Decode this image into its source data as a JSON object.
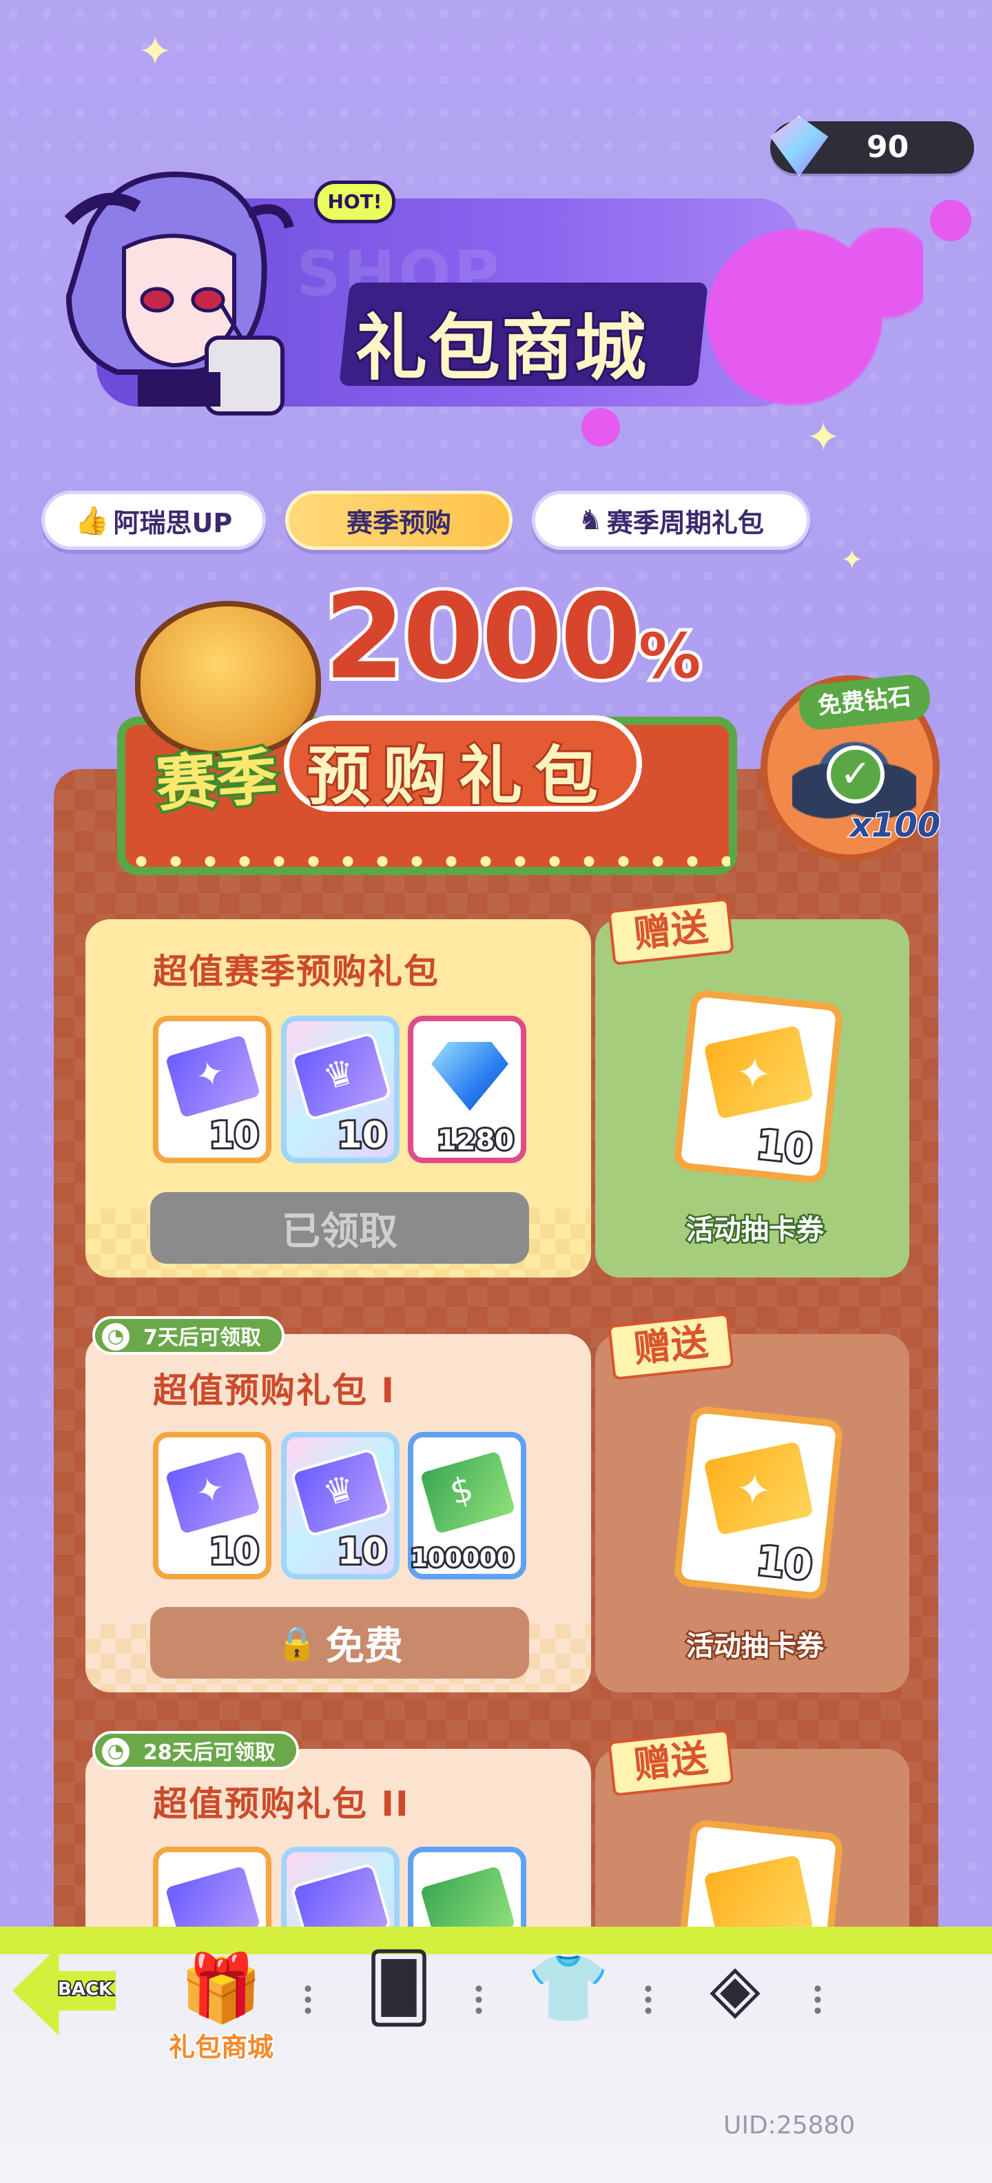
{
  "currency": {
    "diamonds": "90",
    "icon": "diamond-icon"
  },
  "header": {
    "badge": "HOT!",
    "bg_text": "SHOP",
    "title": "礼包商城"
  },
  "tabs": [
    {
      "label": "阿瑞思UP",
      "icon": "thumbs-up-icon"
    },
    {
      "label": "赛季预购",
      "selected": true
    },
    {
      "label": "赛季周期礼包",
      "icon": "character-icon"
    }
  ],
  "banner": {
    "percent_num": "2000",
    "percent_sign": "%",
    "sub_left": "赛季",
    "sub_right": "预购礼包",
    "free_diamond_label": "免费钻石",
    "free_diamond_qty": "x100"
  },
  "packs": [
    {
      "title": "超值赛季预购礼包",
      "items": [
        {
          "type": "purple-ticket",
          "qty": "10"
        },
        {
          "type": "holo-ticket",
          "qty": "10"
        },
        {
          "type": "diamond",
          "qty": "1280"
        }
      ],
      "gift_tag": "赠送",
      "gift": {
        "type": "orange-ticket",
        "qty": "10",
        "label": "活动抽卡券"
      },
      "button": "已领取",
      "timer": ""
    },
    {
      "title": "超值预购礼包 I",
      "items": [
        {
          "type": "purple-ticket",
          "qty": "10"
        },
        {
          "type": "holo-ticket",
          "qty": "10"
        },
        {
          "type": "cash",
          "qty": "100000"
        }
      ],
      "gift_tag": "赠送",
      "gift": {
        "type": "orange-ticket",
        "qty": "10",
        "label": "活动抽卡券"
      },
      "button": "免费",
      "timer": "7天后可领取"
    },
    {
      "title": "超值预购礼包 II",
      "gift_tag": "赠送",
      "timer": "28天后可领取"
    }
  ],
  "bottom_nav": {
    "back": "BACK",
    "items": [
      {
        "label": "礼包商城",
        "icon": "gift-icon",
        "active": true
      },
      {
        "label": "",
        "icon": "card-icon"
      },
      {
        "label": "",
        "icon": "shirt-icon"
      },
      {
        "label": "",
        "icon": "diamond-outline-icon"
      }
    ]
  },
  "uid": "UID:25880",
  "colors": {
    "bg": "#b6a8f4",
    "accent_lime": "#d4ef3d",
    "title_red": "#cc4a2a",
    "board": "#b85a3c"
  }
}
